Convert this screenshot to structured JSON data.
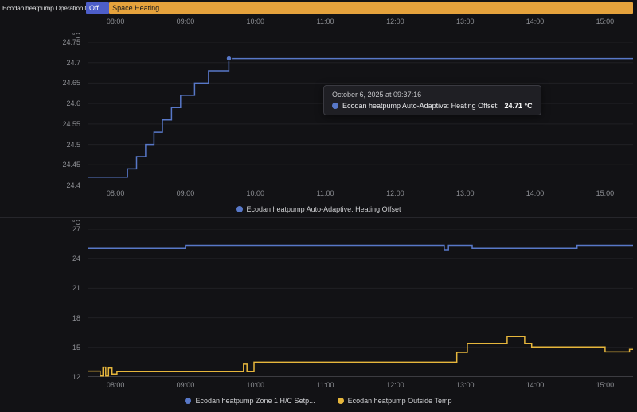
{
  "colors": {
    "background": "#121215",
    "blue": "#5878c8",
    "indigo": "#4d5ec9",
    "amber": "#e5a23c",
    "yellow": "#e6b63c",
    "grid": "#202024",
    "axis_line": "#3c3c41",
    "axis_text": "#8d8f94",
    "legend_text": "#cfd0d3",
    "tooltip_bg": "#1f1f24",
    "tooltip_border": "#3a3a41"
  },
  "time_axis": {
    "domain": [
      7.6,
      15.4
    ],
    "ticks": [
      {
        "t": 8,
        "label": "08:00"
      },
      {
        "t": 9,
        "label": "09:00"
      },
      {
        "t": 10,
        "label": "10:00"
      },
      {
        "t": 11,
        "label": "11:00"
      },
      {
        "t": 12,
        "label": "12:00"
      },
      {
        "t": 13,
        "label": "13:00"
      },
      {
        "t": 14,
        "label": "14:00"
      },
      {
        "t": 15,
        "label": "15:00"
      }
    ]
  },
  "chart_data": [
    {
      "id": "operation-mode-timeline",
      "type": "state-timeline",
      "entity": "Ecodan heatpump Operation Mo...",
      "xticks": [
        "08:00",
        "09:00",
        "10:00",
        "11:00",
        "12:00",
        "13:00",
        "14:00",
        "15:00"
      ],
      "segments": [
        {
          "state": "Off",
          "start": 7.6,
          "end": 7.93,
          "color": "#4d5ec9",
          "text_color": "#ffffff"
        },
        {
          "state": "Space Heating",
          "start": 7.93,
          "end": 15.4,
          "color": "#e5a23c",
          "text_color": "#17181c"
        }
      ]
    },
    {
      "id": "heating-offset",
      "type": "line",
      "ylabel": "°C",
      "ylim": [
        24.4,
        24.75
      ],
      "yticks": [
        24.75,
        24.7,
        24.65,
        24.6,
        24.55,
        24.5,
        24.45,
        24.4
      ],
      "xticks": [
        "08:00",
        "09:00",
        "10:00",
        "11:00",
        "12:00",
        "13:00",
        "14:00",
        "15:00"
      ],
      "legend": [
        {
          "label": "Ecodan heatpump Auto-Adaptive: Heating Offset",
          "color": "#5878c8"
        }
      ],
      "series": [
        {
          "name": "Ecodan heatpump Auto-Adaptive: Heating Offset",
          "color": "#5878c8",
          "step": true,
          "points": [
            [
              7.6,
              24.42
            ],
            [
              8.17,
              24.42
            ],
            [
              8.17,
              24.44
            ],
            [
              8.3,
              24.44
            ],
            [
              8.3,
              24.47
            ],
            [
              8.43,
              24.47
            ],
            [
              8.43,
              24.5
            ],
            [
              8.55,
              24.5
            ],
            [
              8.55,
              24.53
            ],
            [
              8.67,
              24.53
            ],
            [
              8.67,
              24.56
            ],
            [
              8.8,
              24.56
            ],
            [
              8.8,
              24.59
            ],
            [
              8.93,
              24.59
            ],
            [
              8.93,
              24.62
            ],
            [
              9.13,
              24.62
            ],
            [
              9.13,
              24.65
            ],
            [
              9.33,
              24.65
            ],
            [
              9.33,
              24.68
            ],
            [
              9.62,
              24.68
            ],
            [
              9.62,
              24.71
            ],
            [
              15.4,
              24.71
            ]
          ]
        }
      ],
      "marker": {
        "t": 9.6211,
        "v": 24.71,
        "color": "#5878c8"
      },
      "tooltip": {
        "time": "October 6, 2025 at 09:37:16",
        "label": "Ecodan heatpump Auto-Adaptive: Heating Offset:",
        "value": "24.71 °C"
      }
    },
    {
      "id": "zone-setpoint-and-outside-temp",
      "type": "line",
      "ylabel": "°C",
      "ylim": [
        12,
        27
      ],
      "yticks": [
        27,
        24,
        21,
        18,
        15,
        12
      ],
      "xticks": [
        "08:00",
        "09:00",
        "10:00",
        "11:00",
        "12:00",
        "13:00",
        "14:00",
        "15:00"
      ],
      "legend": [
        {
          "label": "Ecodan heatpump Zone 1 H/C Setp...",
          "color": "#5878c8"
        },
        {
          "label": "Ecodan heatpump Outside Temp",
          "color": "#e6b63c"
        }
      ],
      "series": [
        {
          "name": "Ecodan heatpump Zone 1 H/C Setp...",
          "color": "#5878c8",
          "step": true,
          "points": [
            [
              7.6,
              25.05
            ],
            [
              9.0,
              25.05
            ],
            [
              9.0,
              25.35
            ],
            [
              12.7,
              25.35
            ],
            [
              12.7,
              24.9
            ],
            [
              12.76,
              24.9
            ],
            [
              12.76,
              25.35
            ],
            [
              13.1,
              25.35
            ],
            [
              13.1,
              25.05
            ],
            [
              14.6,
              25.05
            ],
            [
              14.6,
              25.35
            ],
            [
              15.4,
              25.35
            ]
          ]
        },
        {
          "name": "Ecodan heatpump Outside Temp",
          "color": "#e6b63c",
          "step": true,
          "points": [
            [
              7.6,
              12.6
            ],
            [
              7.78,
              12.6
            ],
            [
              7.78,
              12.1
            ],
            [
              7.82,
              12.1
            ],
            [
              7.82,
              13.0
            ],
            [
              7.86,
              13.0
            ],
            [
              7.86,
              12.1
            ],
            [
              7.9,
              12.1
            ],
            [
              7.9,
              12.9
            ],
            [
              7.95,
              12.9
            ],
            [
              7.95,
              12.3
            ],
            [
              8.02,
              12.3
            ],
            [
              8.02,
              12.55
            ],
            [
              9.83,
              12.55
            ],
            [
              9.83,
              13.3
            ],
            [
              9.88,
              13.3
            ],
            [
              9.88,
              12.55
            ],
            [
              9.98,
              12.55
            ],
            [
              9.98,
              13.5
            ],
            [
              12.88,
              13.5
            ],
            [
              12.88,
              14.5
            ],
            [
              13.03,
              14.5
            ],
            [
              13.03,
              15.4
            ],
            [
              13.6,
              15.4
            ],
            [
              13.6,
              16.1
            ],
            [
              13.85,
              16.1
            ],
            [
              13.85,
              15.4
            ],
            [
              13.95,
              15.4
            ],
            [
              13.95,
              15.05
            ],
            [
              15.0,
              15.05
            ],
            [
              15.0,
              14.55
            ],
            [
              15.35,
              14.55
            ],
            [
              15.35,
              14.8
            ],
            [
              15.4,
              14.8
            ]
          ]
        }
      ]
    }
  ]
}
